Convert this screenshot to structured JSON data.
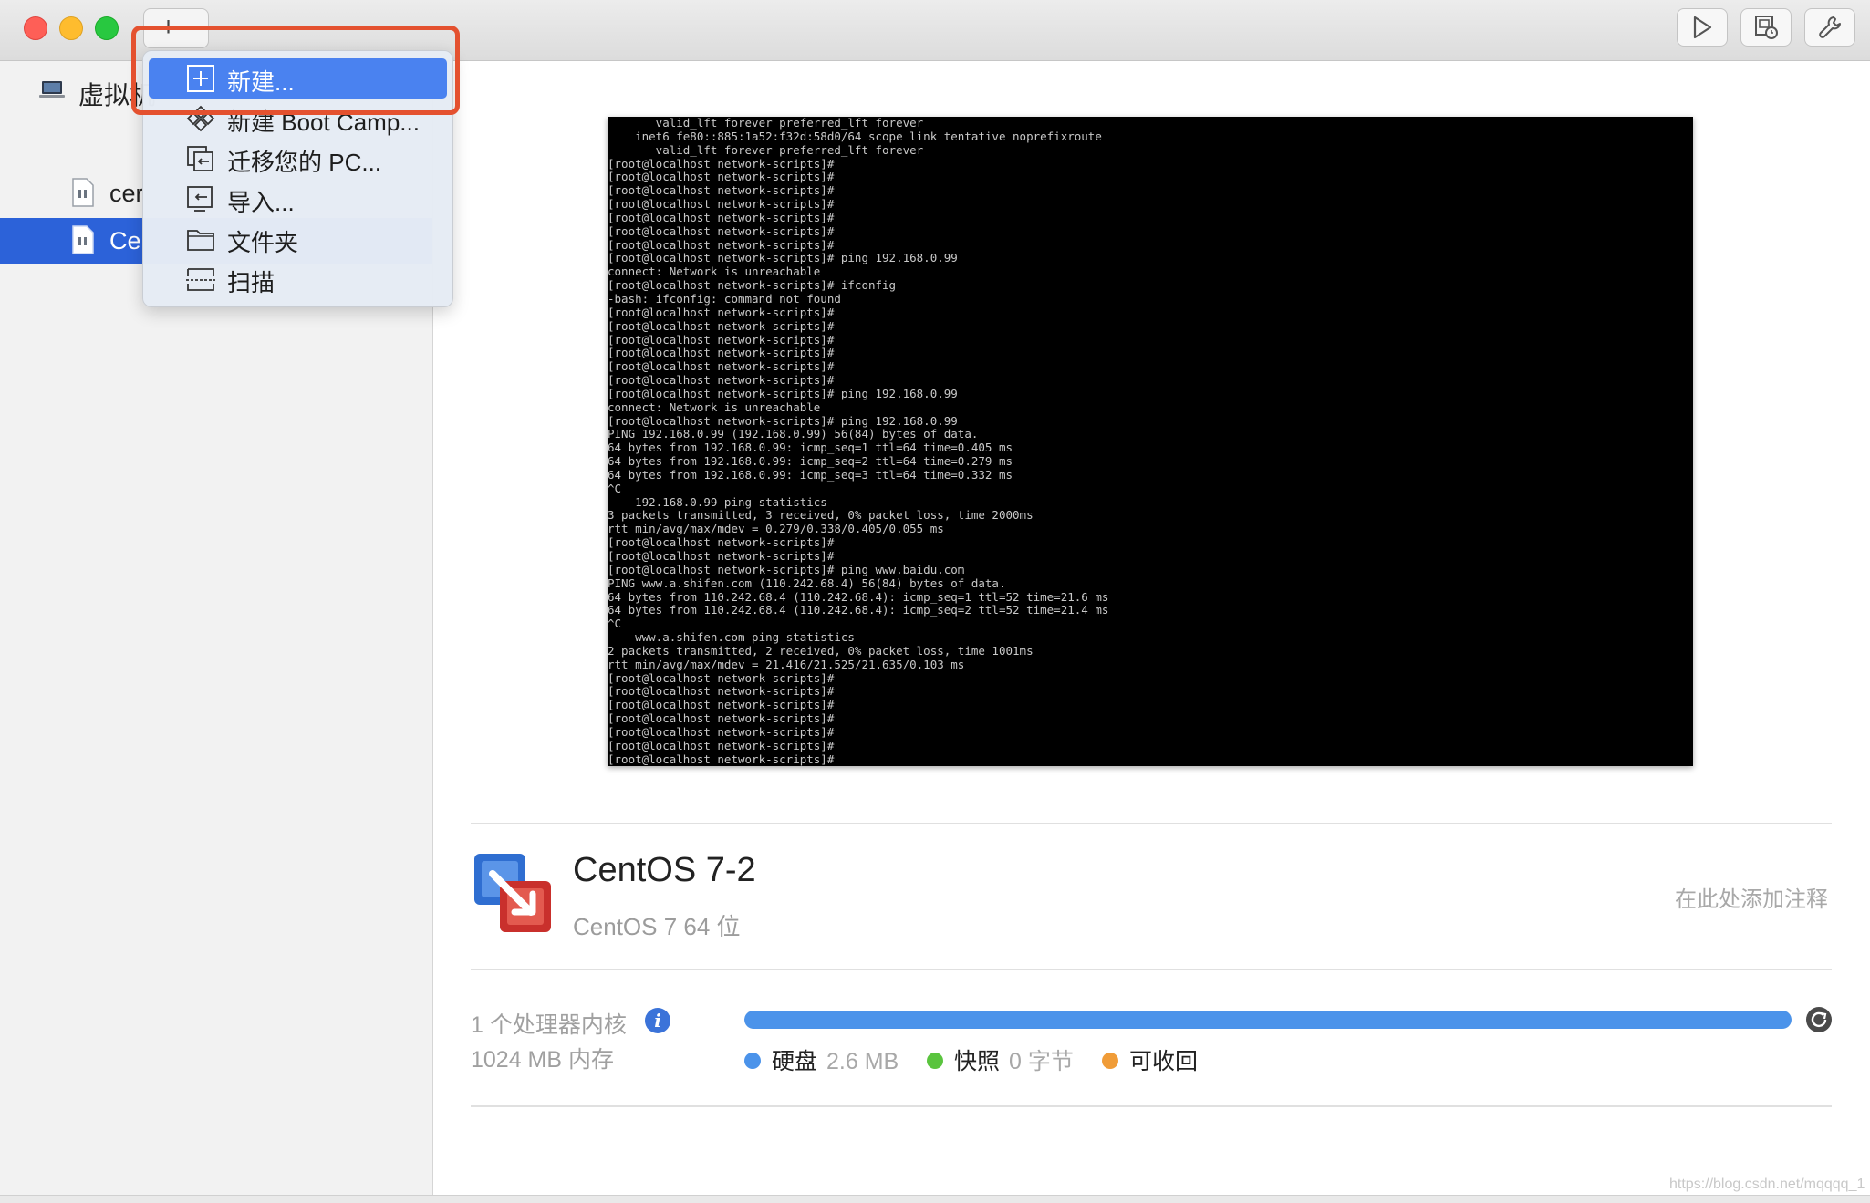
{
  "toolbar": {
    "add_label": "+",
    "add_chevron": "⌄",
    "buttons": [
      "play-icon",
      "snapshot-icon",
      "wrench-icon"
    ]
  },
  "sidebar": {
    "header": "虚拟机",
    "items": [
      {
        "label": "cer"
      },
      {
        "label": "Ce"
      }
    ]
  },
  "menu": {
    "items": [
      {
        "label": "新建...",
        "icon": "plus-box-icon"
      },
      {
        "label": "新建 Boot Camp...",
        "icon": "bootcamp-icon"
      },
      {
        "label": "迁移您的 PC...",
        "icon": "migrate-icon"
      },
      {
        "label": "导入...",
        "icon": "import-icon"
      },
      {
        "label": "文件夹",
        "icon": "folder-icon"
      },
      {
        "label": "扫描",
        "icon": "scan-icon"
      }
    ]
  },
  "console": {
    "lines": [
      "       valid_lft forever preferred_lft forever",
      "    inet6 fe80::885:1a52:f32d:58d0/64 scope link tentative noprefixroute",
      "       valid_lft forever preferred_lft forever",
      "[root@localhost network-scripts]#",
      "[root@localhost network-scripts]#",
      "[root@localhost network-scripts]#",
      "[root@localhost network-scripts]#",
      "[root@localhost network-scripts]#",
      "[root@localhost network-scripts]#",
      "[root@localhost network-scripts]#",
      "[root@localhost network-scripts]# ping 192.168.0.99",
      "connect: Network is unreachable",
      "[root@localhost network-scripts]# ifconfig",
      "-bash: ifconfig: command not found",
      "[root@localhost network-scripts]#",
      "[root@localhost network-scripts]#",
      "[root@localhost network-scripts]#",
      "[root@localhost network-scripts]#",
      "[root@localhost network-scripts]#",
      "[root@localhost network-scripts]#",
      "[root@localhost network-scripts]# ping 192.168.0.99",
      "connect: Network is unreachable",
      "[root@localhost network-scripts]# ping 192.168.0.99",
      "PING 192.168.0.99 (192.168.0.99) 56(84) bytes of data.",
      "64 bytes from 192.168.0.99: icmp_seq=1 ttl=64 time=0.405 ms",
      "64 bytes from 192.168.0.99: icmp_seq=2 ttl=64 time=0.279 ms",
      "64 bytes from 192.168.0.99: icmp_seq=3 ttl=64 time=0.332 ms",
      "^C",
      "--- 192.168.0.99 ping statistics ---",
      "3 packets transmitted, 3 received, 0% packet loss, time 2000ms",
      "rtt min/avg/max/mdev = 0.279/0.338/0.405/0.055 ms",
      "[root@localhost network-scripts]#",
      "[root@localhost network-scripts]#",
      "[root@localhost network-scripts]# ping www.baidu.com",
      "PING www.a.shifen.com (110.242.68.4) 56(84) bytes of data.",
      "64 bytes from 110.242.68.4 (110.242.68.4): icmp_seq=1 ttl=52 time=21.6 ms",
      "64 bytes from 110.242.68.4 (110.242.68.4): icmp_seq=2 ttl=52 time=21.4 ms",
      "^C",
      "--- www.a.shifen.com ping statistics ---",
      "2 packets transmitted, 2 received, 0% packet loss, time 1001ms",
      "rtt min/avg/max/mdev = 21.416/21.525/21.635/0.103 ms",
      "[root@localhost network-scripts]#",
      "[root@localhost network-scripts]#",
      "[root@localhost network-scripts]#",
      "[root@localhost network-scripts]#",
      "[root@localhost network-scripts]#",
      "[root@localhost network-scripts]#",
      "[root@localhost network-scripts]#"
    ]
  },
  "vm": {
    "name": "CentOS 7-2",
    "os": "CentOS 7 64 位",
    "notes_placeholder": "在此处添加注释",
    "cpu": "1 个处理器内核",
    "memory": "1024 MB 内存"
  },
  "storage": {
    "disk_label": "硬盘",
    "disk_value": "2.6 MB",
    "snapshot_label": "快照",
    "snapshot_value": "0 字节",
    "reclaimable_label": "可收回",
    "disk_fraction": 1.0,
    "colors": {
      "disk": "#4b93ea",
      "snapshot": "#5ac43e",
      "reclaimable": "#f09c38"
    }
  },
  "watermark": "https://blog.csdn.net/mqqqq_1"
}
